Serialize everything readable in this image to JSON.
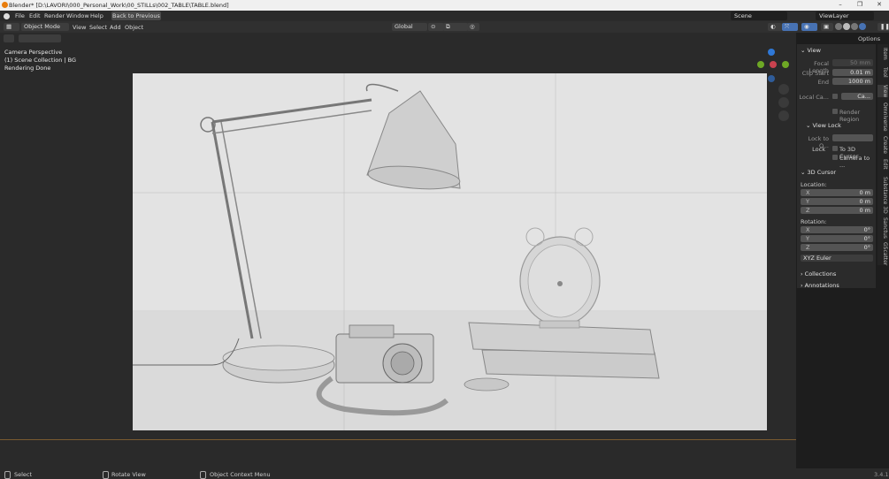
{
  "window": {
    "title": "Blender* [D:\\LAVORI\\000_Personal_Work\\00_STILLs\\002_TABLE\\TABLE.blend]"
  },
  "menu": {
    "items": [
      "File",
      "Edit",
      "Render",
      "Window",
      "Help"
    ],
    "back_button": "Back to Previous",
    "scene": "Scene",
    "view_layer": "ViewLayer"
  },
  "header": {
    "mode": "Object Mode",
    "menus": [
      "View",
      "Select",
      "Add",
      "Object"
    ],
    "transform": "Global",
    "options": "Options"
  },
  "viewport": {
    "line1": "Camera Perspective",
    "line2": "(1) Scene Collection | BG",
    "line3": "Rendering Done"
  },
  "panel": {
    "view_title": "View",
    "focal_length_label": "Focal Length",
    "focal_length_value": "50 mm",
    "clip_start_label": "Clip Start",
    "clip_start_value": "0.01 m",
    "end_label": "End",
    "end_value": "1000 m",
    "local_camera_label": "Local Ca...",
    "local_camera_value": "Ca...",
    "render_region": "Render Region",
    "view_lock_title": "View Lock",
    "lock_to_object_label": "Lock to O...",
    "lock_label": "Lock",
    "to_3d_cursor": "To 3D Cursor",
    "camera_to": "Camera to ...",
    "cursor_title": "3D Cursor",
    "location_label": "Location:",
    "loc_x_label": "X",
    "loc_x": "0 m",
    "loc_y_label": "Y",
    "loc_y": "0 m",
    "loc_z_label": "Z",
    "loc_z": "0 m",
    "rotation_label": "Rotation:",
    "rot_x_label": "X",
    "rot_x": "0°",
    "rot_y_label": "Y",
    "rot_y": "0°",
    "rot_z_label": "Z",
    "rot_z": "0°",
    "rotation_mode": "XYZ Euler",
    "collections": "Collections",
    "annotations": "Annotations"
  },
  "sidetabs": [
    "Item",
    "Tool",
    "View",
    "Omniverse",
    "Create",
    "Edit",
    "Substance 3D",
    "Sanctus",
    "GScatter"
  ],
  "status": {
    "select": "Select",
    "rotate": "Rotate View",
    "context": "Object Context Menu",
    "version": "3.4.1"
  }
}
